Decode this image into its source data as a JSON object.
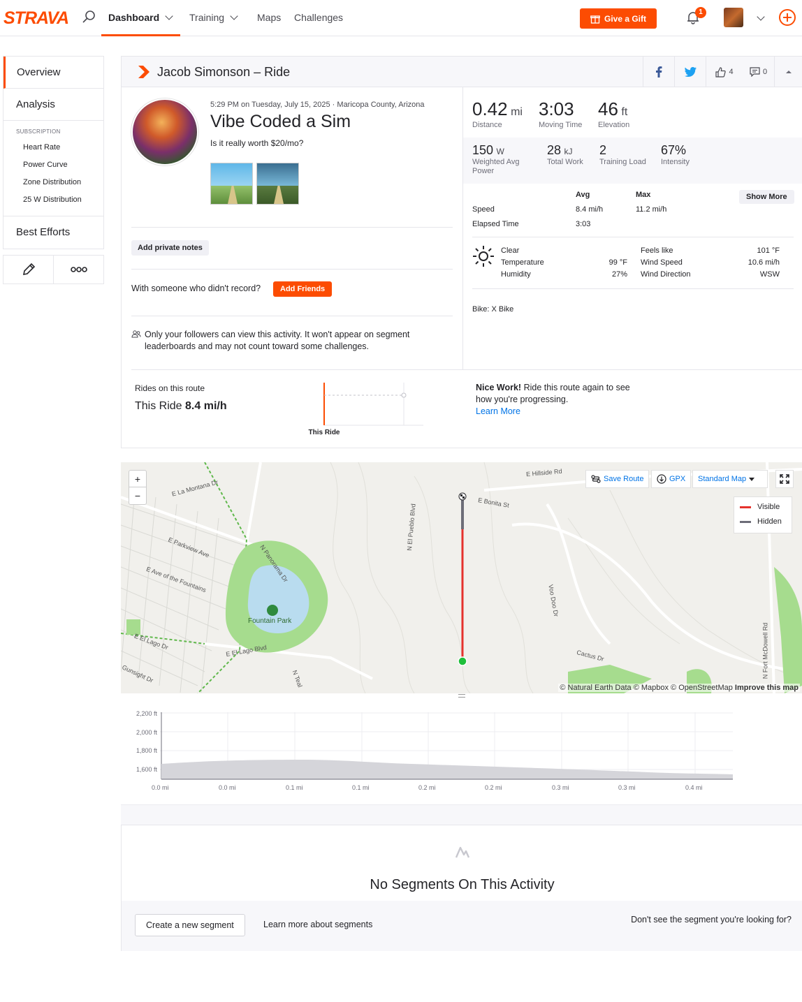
{
  "nav": {
    "logo": "STRAVA",
    "items": [
      "Dashboard",
      "Training",
      "Maps",
      "Challenges"
    ],
    "gift_label": "Give a Gift",
    "notification_count": "1"
  },
  "sidebar": {
    "overview": "Overview",
    "analysis": "Analysis",
    "subscription_title": "SUBSCRIPTION",
    "sub_items": [
      "Heart Rate",
      "Power Curve",
      "Zone Distribution",
      "25 W Distribution"
    ],
    "best_efforts": "Best Efforts"
  },
  "activity": {
    "header_title": "Jacob Simonson – Ride",
    "kudos_count": "4",
    "comment_count": "0",
    "meta": "5:29 PM on Tuesday, July 15, 2025 · Maricopa County, Arizona",
    "name": "Vibe Coded a Sim",
    "description": "Is it really worth $20/mo?",
    "private_notes_label": "Add private notes",
    "with_someone": "With someone who didn't record?",
    "add_friends_label": "Add Friends",
    "privacy_text": "Only your followers can view this activity. It won't appear on segment leaderboards and may not count toward some challenges."
  },
  "stats": {
    "distance": {
      "value": "0.42",
      "unit": "mi",
      "label": "Distance"
    },
    "moving_time": {
      "value": "3:03",
      "label": "Moving Time"
    },
    "elevation": {
      "value": "46",
      "unit": "ft",
      "label": "Elevation"
    },
    "weighted_power": {
      "value": "150",
      "unit": "W",
      "label": "Weighted Avg Power"
    },
    "total_work": {
      "value": "28",
      "unit": "kJ",
      "label": "Total Work"
    },
    "training_load": {
      "value": "2",
      "label": "Training Load"
    },
    "intensity": {
      "value": "67%",
      "label": "Intensity"
    }
  },
  "more_stats": {
    "col_avg": "Avg",
    "col_max": "Max",
    "show_more": "Show More",
    "speed_label": "Speed",
    "speed_avg": "8.4 mi/h",
    "speed_max": "11.2 mi/h",
    "elapsed_label": "Elapsed Time",
    "elapsed_avg": "3:03"
  },
  "weather": {
    "condition": "Clear",
    "temperature_label": "Temperature",
    "temperature": "99 °F",
    "humidity_label": "Humidity",
    "humidity": "27%",
    "feels_like_label": "Feels like",
    "feels_like": "101 °F",
    "wind_speed_label": "Wind Speed",
    "wind_speed": "10.6 mi/h",
    "wind_direction_label": "Wind Direction",
    "wind_direction": "WSW"
  },
  "bike": "Bike: X Bike",
  "routes": {
    "title": "Rides on this route",
    "value_prefix": "This Ride",
    "value": "8.4 mi/h",
    "chart_label": "This Ride",
    "nice_bold": "Nice Work!",
    "nice_text": "Ride this route again to see how you're progressing.",
    "learn_more": "Learn More"
  },
  "map": {
    "save_route": "Save Route",
    "gpx": "GPX",
    "map_type": "Standard Map",
    "legend_visible": "Visible",
    "legend_hidden": "Hidden",
    "labels": [
      "E Hillside Rd",
      "E La Montana Dr",
      "E Bonita St",
      "N El Pueblo Blvd",
      "E Parkview Ave",
      "E Ave of the Fountains",
      "N Panorama Dr",
      "Fountain Park",
      "E El Lago Dr",
      "E El Lago Blvd",
      "Gunsight Dr",
      "N Teal",
      "Cactus Dr",
      "Voo Doo Dr",
      "N Fort McDowell Rd"
    ],
    "attribution": "© Natural Earth Data © Mapbox © OpenStreetMap",
    "improve": "Improve this map",
    "colors": {
      "visible": "#e5322d",
      "hidden": "#6d6d78",
      "park": "#a6dc8e",
      "water": "#b9dcef"
    }
  },
  "elevation": {
    "y_ticks": [
      "2,200 ft",
      "2,000 ft",
      "1,800 ft",
      "1,600 ft"
    ],
    "x_ticks": [
      "0.0 mi",
      "0.0 mi",
      "0.1 mi",
      "0.1 mi",
      "0.2 mi",
      "0.2 mi",
      "0.3 mi",
      "0.3 mi",
      "0.4 mi"
    ]
  },
  "segments": {
    "title": "No Segments On This Activity",
    "create_label": "Create a new segment",
    "learn_label": "Learn more about segments",
    "right_text": "Don't see the segment you're looking for?"
  }
}
